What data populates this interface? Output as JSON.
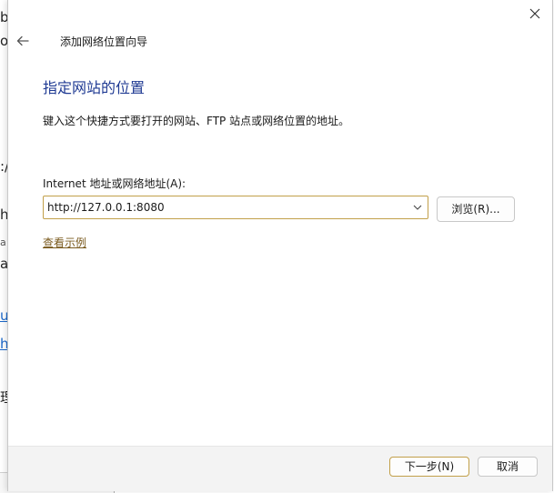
{
  "background": {
    "fragments": [
      "b",
      "o",
      ":/",
      "h",
      "a",
      "a",
      "u",
      "h",
      "理"
    ]
  },
  "dialog": {
    "title": "添加网络位置向导",
    "heading": "指定网站的位置",
    "instruction": "键入这个快捷方式要打开的网站、FTP 站点或网络位置的地址。",
    "address_label": "Internet 地址或网络地址(A):",
    "address_value": "http://127.0.0.1:8080",
    "browse_label": "浏览(R)...",
    "example_link": "查看示例",
    "next_label": "下一步(N)",
    "cancel_label": "取消"
  },
  "colors": {
    "heading": "#1f3a93",
    "focus_border": "#c2a04a",
    "link": "#7a5a1e",
    "footer_bg": "#f3f3f3"
  },
  "icons": {
    "close": "close-icon",
    "back": "back-arrow-icon",
    "dropdown": "chevron-down-icon"
  }
}
